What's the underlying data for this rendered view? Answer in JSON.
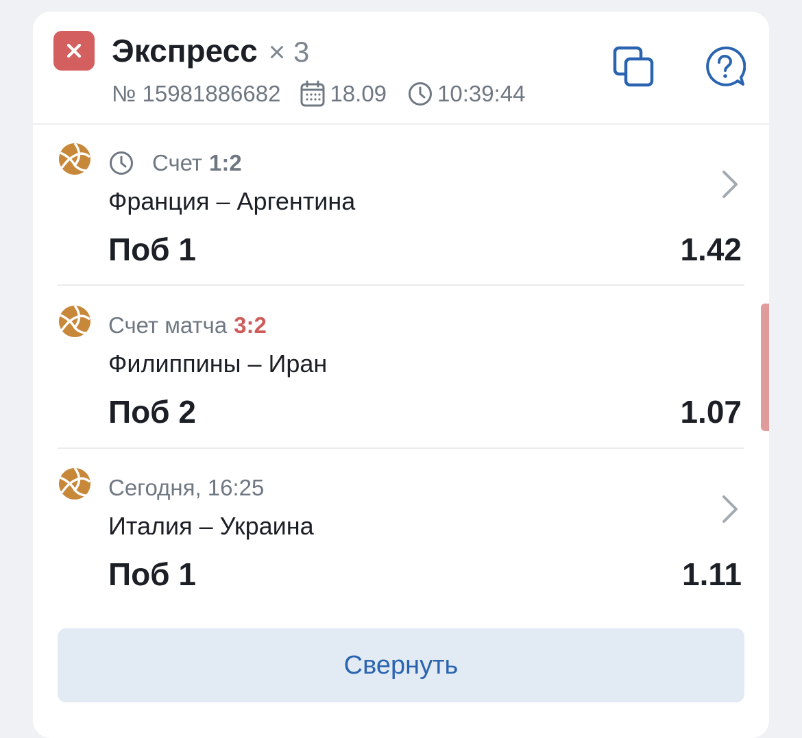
{
  "bet": {
    "title": "Экспресс",
    "multiplier": "× 3",
    "number": "№ 15981886682",
    "date": "18.09",
    "time": "10:39:44"
  },
  "events": [
    {
      "info_label": "Счет",
      "score": "1:2",
      "teams": "Франция – Аргентина",
      "pick": "Поб 1",
      "odds": "1.42"
    },
    {
      "info_label": "Счет матча",
      "score": "3:2",
      "teams": "Филиппины – Иран",
      "pick": "Поб 2",
      "odds": "1.07"
    },
    {
      "info_label": "Сегодня, 16:25",
      "teams": "Италия – Украина",
      "pick": "Поб 1",
      "odds": "1.11"
    }
  ],
  "collapse_label": "Свернуть",
  "colors": {
    "lost_status": "#d45f5f",
    "live_score": "#cf5a5a",
    "accent": "#2a64b0",
    "sport_icon": "#c8883a"
  },
  "icons": [
    "close-icon",
    "calendar-icon",
    "clock-icon",
    "copy-icon",
    "help-icon",
    "volleyball-icon",
    "chevron-right-icon"
  ]
}
